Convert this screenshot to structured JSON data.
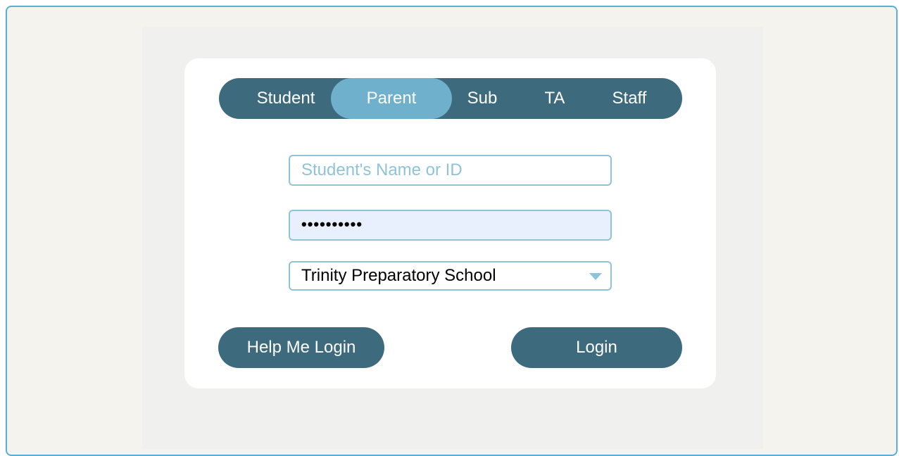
{
  "roles": [
    {
      "label": "Student",
      "active": false
    },
    {
      "label": "Parent",
      "active": true
    },
    {
      "label": "Sub",
      "active": false
    },
    {
      "label": "TA",
      "active": false
    },
    {
      "label": "Staff",
      "active": false
    }
  ],
  "form": {
    "username_placeholder": "Student's Name or ID",
    "password_value": "••••••••••",
    "school_selected": "Trinity Preparatory School"
  },
  "buttons": {
    "help_label": "Help Me Login",
    "login_label": "Login"
  },
  "colors": {
    "primary": "#3d6a7c",
    "active_tab": "#6fb0cc",
    "field_border": "#8fc3d7",
    "frame_border": "#5aaed3"
  },
  "icons": {
    "school_dropdown": "chevron-down-icon"
  }
}
